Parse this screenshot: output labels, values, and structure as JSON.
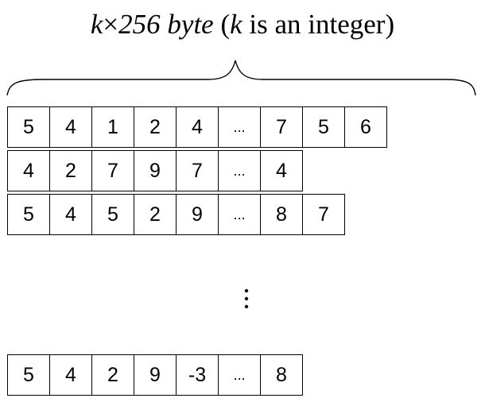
{
  "title": {
    "k": "k",
    "times": "×",
    "amount": "256 byte",
    "paren_open": " (",
    "k2": "k",
    "rest": " is an integer)"
  },
  "rows": [
    [
      "5",
      "4",
      "1",
      "2",
      "4",
      "...",
      "7",
      "5",
      "6"
    ],
    [
      "4",
      "2",
      "7",
      "9",
      "7",
      "...",
      "4"
    ],
    [
      "5",
      "4",
      "5",
      "2",
      "9",
      "...",
      "8",
      "7"
    ],
    [
      "5",
      "4",
      "2",
      "9",
      "-3",
      "...",
      "8"
    ]
  ],
  "vertical_ellipsis": "⋮"
}
